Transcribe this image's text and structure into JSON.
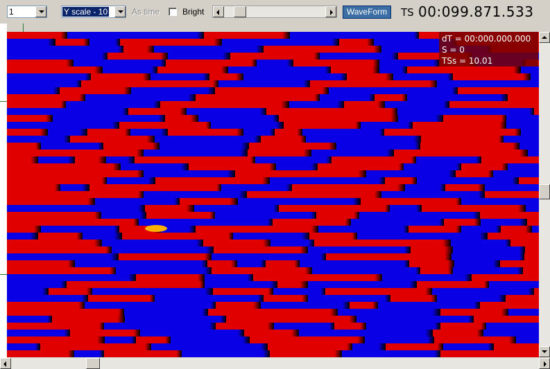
{
  "toolbar": {
    "channel_select": {
      "value": "1"
    },
    "yscale_select": {
      "value": "Y scale - 10"
    },
    "as_time_label": "As time",
    "bright_label": "Bright",
    "waveform_button": "WaveForm",
    "ts_label": "TS",
    "ts_value": "00:099.871.533"
  },
  "overlay": {
    "dt": "dT = 00:000.000.000",
    "s": "S = 0",
    "tss": "TSs = 10.01"
  },
  "heatmap": {
    "colors": {
      "low": "#0a00e6",
      "high": "#e00000",
      "edge": "#000000",
      "hot": "#ffb000"
    }
  }
}
